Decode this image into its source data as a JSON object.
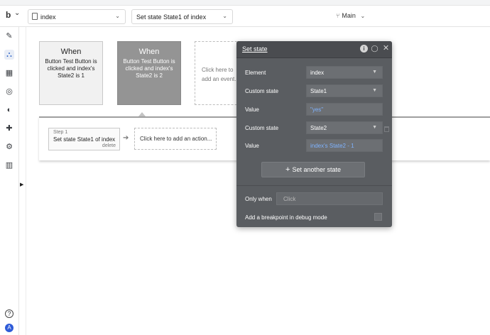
{
  "topbar": {
    "logo_text": "b",
    "page_select": "index",
    "action_select": "Set state State1 of index",
    "branch": "Main"
  },
  "left_rail": {
    "icons": [
      "pencil-icon",
      "workflow-icon",
      "layout-icon",
      "database-icon",
      "palette-icon",
      "plugin-icon",
      "settings-icon",
      "chart-icon"
    ],
    "bottom": [
      "help-icon",
      "account-icon"
    ],
    "account_letter": "A",
    "active_color": "#3367c7"
  },
  "events": [
    {
      "when": "When",
      "desc": "Button Test Button is clicked and index's State2 is 1"
    },
    {
      "when": "When",
      "desc": "Button Test Button is clicked and index's State2 is 2"
    }
  ],
  "add_event": "Click here to add an event...",
  "step": {
    "label": "Step 1",
    "title": "Set state State1 of index",
    "delete": "delete"
  },
  "add_action": "Click here to add an action...",
  "panel": {
    "title": "Set state",
    "rows": {
      "element_label": "Element",
      "element_value": "index",
      "custom_state_label_1": "Custom state",
      "custom_state_value_1": "State1",
      "value_label_1": "Value",
      "value_1": "\"yes\"",
      "custom_state_label_2": "Custom state",
      "custom_state_value_2": "State2",
      "value_label_2": "Value",
      "value_2": "index's State2 - 1"
    },
    "another_button": "Set another state",
    "only_when_label": "Only when",
    "only_when_placeholder": "Click",
    "breakpoint_label": "Add a breakpoint in debug mode",
    "colors": {
      "bg": "#5a5d61",
      "link": "#7fb3ff"
    }
  }
}
